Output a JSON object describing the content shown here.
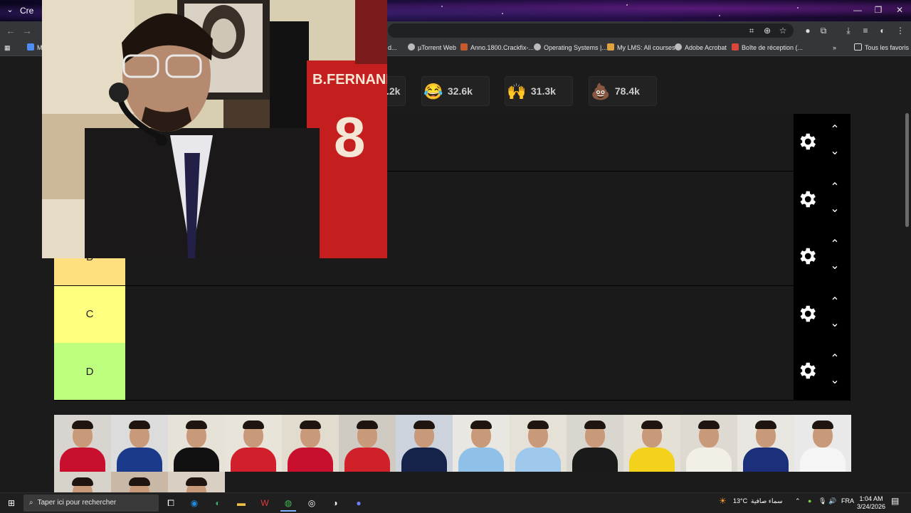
{
  "browser": {
    "tab_title": "Cre",
    "bookmarks": [
      {
        "label": "M",
        "color": "#4f8df5"
      },
      {
        "label": "d...",
        "color": "#888"
      },
      {
        "label": "µTorrent Web",
        "color": "#bbb"
      },
      {
        "label": "Anno.1800.Crackfix-...",
        "color": "#c75b2b"
      },
      {
        "label": "Operating Systems |...",
        "color": "#bbb"
      },
      {
        "label": "My LMS: All courses",
        "color": "#e2a33d"
      },
      {
        "label": "Adobe Acrobat",
        "color": "#bbb"
      },
      {
        "label": "Boîte de réception (...",
        "color": "#d9463b"
      },
      {
        "label": "Tous les favoris",
        "color": "#ddd"
      }
    ]
  },
  "reactions": [
    {
      "emoji": "",
      "count": ".2k"
    },
    {
      "emoji": "😂",
      "count": "32.6k"
    },
    {
      "emoji": "🙌",
      "count": "31.3k"
    },
    {
      "emoji": "💩",
      "count": "78.4k"
    }
  ],
  "tiers": [
    {
      "label": "",
      "color": "#1a1a1a"
    },
    {
      "label": "",
      "color": "#1a1a1a"
    },
    {
      "label": "B",
      "color": "#ffdf80"
    },
    {
      "label": "C",
      "color": "#ffff7f"
    },
    {
      "label": "D",
      "color": "#bfff7f"
    }
  ],
  "pool": [
    {
      "wall": "#d8d4cf",
      "shirt": "#c8102e"
    },
    {
      "wall": "#dcdcdc",
      "shirt": "#1b3a8c"
    },
    {
      "wall": "#e6e2d8",
      "shirt": "#111111"
    },
    {
      "wall": "#e9e4d9",
      "shirt": "#d11f2b"
    },
    {
      "wall": "#e2dccf",
      "shirt": "#c8102e"
    },
    {
      "wall": "#cfcac2",
      "shirt": "#d0202a"
    },
    {
      "wall": "#ccd3dd",
      "shirt": "#15224a"
    },
    {
      "wall": "#e8e7e2",
      "shirt": "#8fc1e8"
    },
    {
      "wall": "#e6e1d6",
      "shirt": "#9ec8ec"
    },
    {
      "wall": "#d9d6d0",
      "shirt": "#1a1a1a"
    },
    {
      "wall": "#e4e0d6",
      "shirt": "#f2d21b"
    },
    {
      "wall": "#dedad2",
      "shirt": "#f1efe6"
    },
    {
      "wall": "#e8e6e1",
      "shirt": "#1b2f7a"
    },
    {
      "wall": "#e9e9e9",
      "shirt": "#f5f5f5"
    },
    {
      "wall": "#d7d2ca",
      "shirt": "#c8102e"
    },
    {
      "wall": "#c9b8a6",
      "shirt": "#3a3a3a"
    },
    {
      "wall": "#d9d0c3",
      "shirt": "#5a4a3a"
    }
  ],
  "taskbar": {
    "search_placeholder": "Taper ici pour rechercher",
    "weather_temp": "13°C",
    "weather_text": "سماء صافية",
    "language": "FRA",
    "time": "1:04 AM",
    "date": "3/24/2026"
  }
}
